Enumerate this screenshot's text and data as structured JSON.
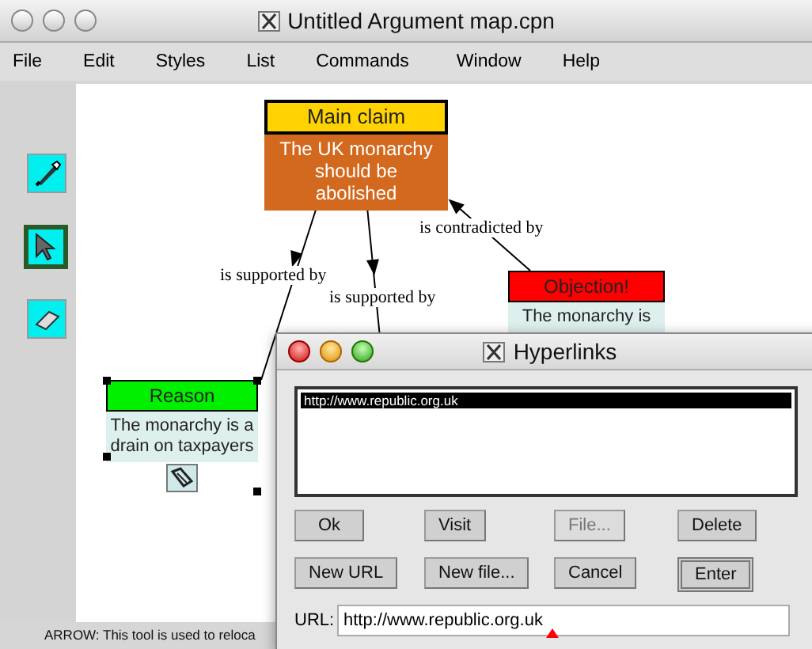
{
  "window": {
    "title": "Untitled Argument map.cpn"
  },
  "menu": [
    "File",
    "Edit",
    "Styles",
    "List",
    "Commands",
    "Window",
    "Help"
  ],
  "tools": [
    {
      "kind": "pen",
      "selected": false
    },
    {
      "kind": "arrow",
      "selected": true
    },
    {
      "kind": "eraser",
      "selected": false
    }
  ],
  "nodes": [
    {
      "kind": "main",
      "heading": "Main claim",
      "color": "#ffd200",
      "body": "The UK monarchy should be abolished",
      "selected": false,
      "has_link": false
    },
    {
      "kind": "reason",
      "heading": "Reason",
      "color": "#00f000",
      "body": "The monarchy is a drain on taxpayers",
      "selected": true,
      "has_link": true
    },
    {
      "kind": "objection",
      "heading": "Objection!",
      "color": "#ff0000",
      "body": "The monarchy is",
      "selected": false,
      "has_link": false
    }
  ],
  "links": [
    {
      "label": "is supported by"
    },
    {
      "label": "is supported by"
    },
    {
      "label": "is contradicted by"
    }
  ],
  "status_bar": "ARROW: This tool is used to reloca",
  "dialog": {
    "title": "Hyperlinks",
    "list": [
      {
        "text": "http://www.republic.org.uk",
        "selected": true
      }
    ],
    "buttons": [
      {
        "label": "Ok",
        "disabled": false,
        "default": false
      },
      {
        "label": "Visit",
        "disabled": false,
        "default": false
      },
      {
        "label": "File...",
        "disabled": true,
        "default": false
      },
      {
        "label": "Delete",
        "disabled": false,
        "default": false
      },
      {
        "label": "New URL",
        "disabled": false,
        "default": false
      },
      {
        "label": "New file...",
        "disabled": false,
        "default": false
      },
      {
        "label": "Cancel",
        "disabled": false,
        "default": false
      },
      {
        "label": "Enter",
        "disabled": false,
        "default": true
      }
    ],
    "url_label": "URL:",
    "url_value": "http://www.republic.org.uk"
  }
}
